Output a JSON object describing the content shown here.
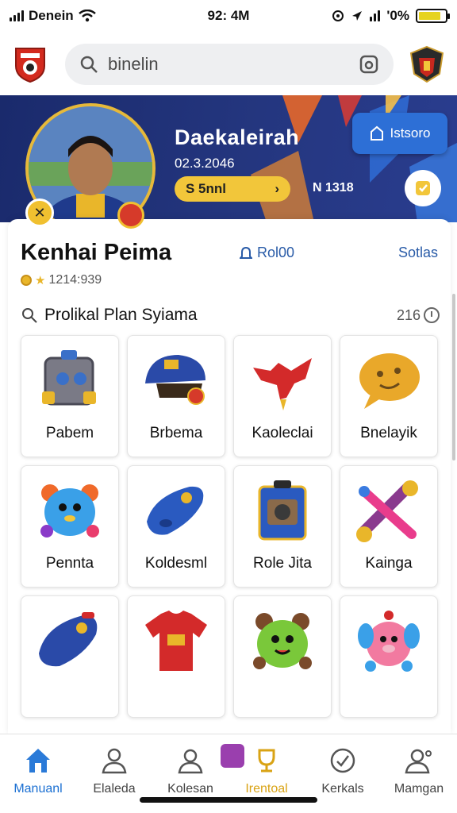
{
  "status_bar": {
    "carrier": "Denein",
    "time": "92: 4M",
    "battery": "'0%",
    "battery_level": 0.85
  },
  "search": {
    "text": "binelin"
  },
  "hero": {
    "name": "Daekaleirah",
    "date": "02.3.2046",
    "pill_text": "S 5nnl",
    "pill_arrow": "›",
    "stat": "N 1318",
    "button_label": "Istsoro",
    "round_icon": "badge-icon"
  },
  "section": {
    "title": "Kenhai Peima",
    "subtitle": "1214:939",
    "count": "Rol00",
    "link": "Sotlas"
  },
  "filter": {
    "title": "Prolikal Plan Syiama",
    "count": "216"
  },
  "items": [
    {
      "label": "Pabem",
      "icon": "toy-box-icon"
    },
    {
      "label": "Brbema",
      "icon": "cap-icon"
    },
    {
      "label": "Kaoleclai",
      "icon": "red-dragon-icon"
    },
    {
      "label": "Bnelayik",
      "icon": "chat-bubble-icon"
    },
    {
      "label": "Pennta",
      "icon": "blue-creature-icon"
    },
    {
      "label": "Koldesml",
      "icon": "blue-whistle-icon"
    },
    {
      "label": "Role Jita",
      "icon": "blue-case-icon"
    },
    {
      "label": "Kainga",
      "icon": "cross-toy-icon"
    },
    {
      "label": "",
      "icon": "blue-controller-icon"
    },
    {
      "label": "",
      "icon": "jersey-icon"
    },
    {
      "label": "",
      "icon": "green-bear-icon"
    },
    {
      "label": "",
      "icon": "pink-creature-icon"
    }
  ],
  "nav": [
    {
      "label": "Manuanl",
      "icon": "home-icon",
      "active": true
    },
    {
      "label": "Elaleda",
      "icon": "people-icon",
      "active": false
    },
    {
      "label": "Kolesan",
      "icon": "group-icon",
      "active": false
    },
    {
      "label": "Irentoal",
      "icon": "trophy-icon",
      "active": false
    },
    {
      "label": "Kerkals",
      "icon": "check-circle-icon",
      "active": false
    },
    {
      "label": "Mamgan",
      "icon": "user-icon",
      "active": false
    }
  ]
}
